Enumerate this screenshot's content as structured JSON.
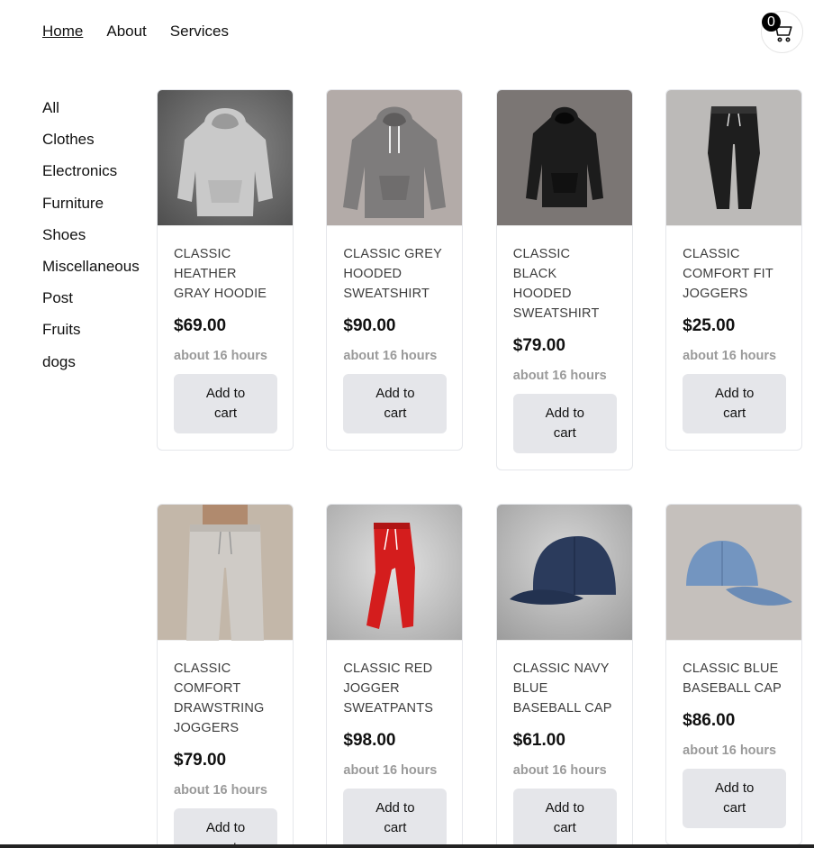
{
  "nav": {
    "links": [
      "Home",
      "About",
      "Services"
    ]
  },
  "cart": {
    "count": "0"
  },
  "sidebar": {
    "categories": [
      "All",
      "Clothes",
      "Electronics",
      "Furniture",
      "Shoes",
      "Miscellaneous",
      "Post",
      "Fruits",
      "dogs"
    ]
  },
  "products": [
    {
      "title": "CLASSIC HEATHER GRAY HOODIE",
      "price": "$69.00",
      "time": "about 16 hours",
      "button": "Add to cart"
    },
    {
      "title": "CLASSIC GREY HOODED SWEATSHIRT",
      "price": "$90.00",
      "time": "about 16 hours",
      "button": "Add to cart"
    },
    {
      "title": "CLASSIC BLACK HOODED SWEATSHIRT",
      "price": "$79.00",
      "time": "about 16 hours",
      "button": "Add to cart"
    },
    {
      "title": "CLASSIC COMFORT FIT JOGGERS",
      "price": "$25.00",
      "time": "about 16 hours",
      "button": "Add to cart"
    },
    {
      "title": "CLASSIC COMFORT DRAWSTRING JOGGERS",
      "price": "$79.00",
      "time": "about 16 hours",
      "button": "Add to cart"
    },
    {
      "title": "CLASSIC RED JOGGER SWEATPANTS",
      "price": "$98.00",
      "time": "about 16 hours",
      "button": "Add to cart"
    },
    {
      "title": "CLASSIC NAVY BLUE BASEBALL CAP",
      "price": "$61.00",
      "time": "about 16 hours",
      "button": "Add to cart"
    },
    {
      "title": "CLASSIC BLUE BASEBALL CAP",
      "price": "$86.00",
      "time": "about 16 hours",
      "button": "Add to cart"
    }
  ]
}
